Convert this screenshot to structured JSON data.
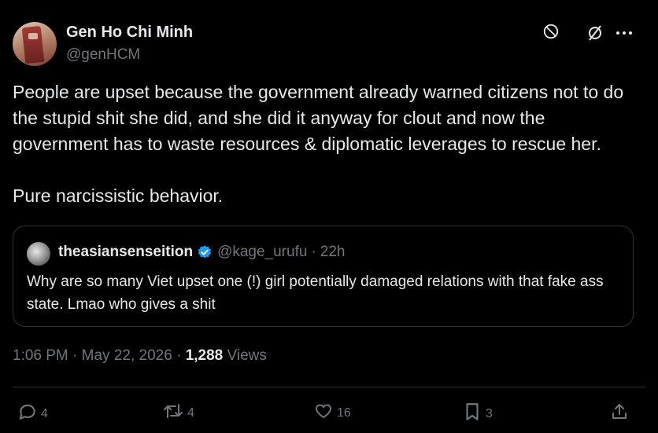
{
  "author": {
    "display_name": "Gen Ho Chi Minh",
    "handle": "@genHCM"
  },
  "header_icons": [
    "grok-icon",
    "no-slash-icon",
    "more-icon"
  ],
  "tweet": {
    "text": "People are upset because the government already warned citizens not to do the stupid shit she did, and she did it anyway for clout and now the government has to waste resources & diplomatic leverages to rescue her.\n\nPure narcissistic behavior."
  },
  "quote": {
    "display_name": "theasiansenseition",
    "handle": "@kage_urufu",
    "separator": "·",
    "time": "22h",
    "text": "Why are so many Viet upset one (!) girl potentially damaged relations with that fake ass state. Lmao who gives a shit"
  },
  "meta": {
    "time": "1:06 PM",
    "separator": " · ",
    "date": "May 22, 2026",
    "views_count": "1,288",
    "views_label": "Views"
  },
  "actions": {
    "replies": "4",
    "reposts": "4",
    "likes": "16",
    "bookmarks": "3"
  },
  "colors": {
    "background": "#000000",
    "text": "#e7e9ea",
    "muted": "#71767b",
    "border": "#2f3336",
    "verified": "#1d9bf0"
  }
}
